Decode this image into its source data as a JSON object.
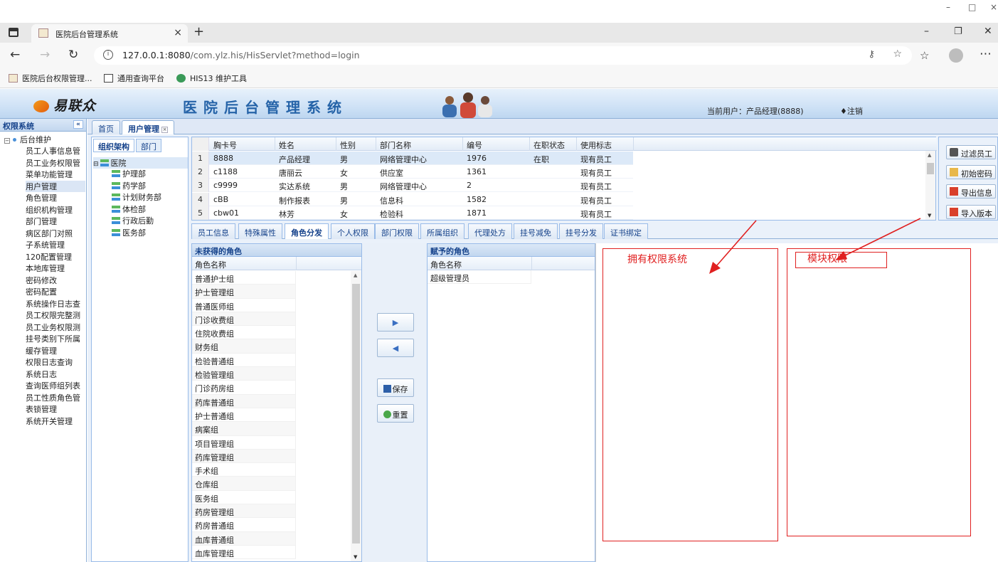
{
  "window": {
    "minimize": "–",
    "maximize": "□",
    "close": "×"
  },
  "browser": {
    "tab_title": "医院后台管理系统",
    "url_host": "127.0.0.1:8080",
    "url_path": "/com.ylz.his/HisServlet?method=login",
    "tab_controls": {
      "minimize": "–",
      "restore": "❐",
      "close": "✕"
    },
    "bookmarks": [
      "医院后台权限管理...",
      "通用查询平台",
      "HIS13 维护工具"
    ]
  },
  "header": {
    "logo_text": "易联众",
    "system_title": "医院后台管理系统",
    "current_user": "当前用户：产品经理(8888)",
    "logout": "♦注销"
  },
  "sidebar": {
    "title": "权限系统",
    "collapse": "«",
    "root": "后台维护",
    "items": [
      "员工人事信息管",
      "员工业务权限管",
      "菜单功能管理",
      "用户管理",
      "角色管理",
      "组织机构管理",
      "部门管理",
      "病区部门对照",
      "子系统管理",
      "120配置管理",
      "本地库管理",
      "密码修改",
      "密码配置",
      "系统操作日志查",
      "员工权限完整测",
      "员工业务权限测",
      "挂号类别下所属",
      "缓存管理",
      "权限日志查询",
      "系统日志",
      "查询医师组列表",
      "员工性质角色管",
      "表锁管理",
      "系统开关管理"
    ],
    "selected_index": 3
  },
  "main_tabs": [
    "首页",
    "用户管理"
  ],
  "org_panel": {
    "tabs": [
      "组织架构",
      "部门"
    ],
    "root": "医院",
    "children": [
      "护理部",
      "药学部",
      "计划财务部",
      "体检部",
      "行政后勤",
      "医务部"
    ]
  },
  "staff_grid": {
    "columns": [
      "胸卡号",
      "姓名",
      "性别",
      "部门名称",
      "编号",
      "在职状态",
      "使用标志"
    ],
    "rows": [
      {
        "n": "1",
        "card": "8888",
        "name": "产品经理",
        "sex": "男",
        "dept": "网络管理中心",
        "code": "1976",
        "status": "在职",
        "flag": "现有员工"
      },
      {
        "n": "2",
        "card": "c1188",
        "name": "唐丽云",
        "sex": "女",
        "dept": "供应室",
        "code": "1361",
        "status": "",
        "flag": "现有员工"
      },
      {
        "n": "3",
        "card": "c9999",
        "name": "实达系统",
        "sex": "男",
        "dept": "网络管理中心",
        "code": "2",
        "status": "",
        "flag": "现有员工"
      },
      {
        "n": "4",
        "card": "cBB",
        "name": "制作报表",
        "sex": "男",
        "dept": "信息科",
        "code": "1582",
        "status": "",
        "flag": "现有员工"
      },
      {
        "n": "5",
        "card": "cbw01",
        "name": "林芳",
        "sex": "女",
        "dept": "检验科",
        "code": "1871",
        "status": "",
        "flag": "现有员工"
      }
    ]
  },
  "side_buttons": [
    "过滤员工",
    "初始密码",
    "导出信息",
    "导入版本"
  ],
  "sub_tabs": [
    "员工信息",
    "特殊属性",
    "角色分发",
    "个人权限",
    "部门权限",
    "所属组织",
    "代理处方",
    "挂号减免",
    "挂号分发",
    "证书绑定"
  ],
  "sub_tab_active": 2,
  "unassigned": {
    "title": "未获得的角色",
    "column": "角色名称",
    "roles": [
      "普通护士组",
      "护士管理组",
      "普通医师组",
      "门诊收费组",
      "住院收费组",
      "财务组",
      "检验普通组",
      "检验管理组",
      "门诊药房组",
      "药库普通组",
      "护士普通组",
      "病案组",
      "项目管理组",
      "药库管理组",
      "手术组",
      "仓库组",
      "医务组",
      "药房管理组",
      "药房普通组",
      "血库普通组",
      "血库管理组"
    ]
  },
  "move_buttons": {
    "add": "▶",
    "remove": "◀",
    "save": "保存",
    "reset": "重置"
  },
  "assigned": {
    "title": "赋予的角色",
    "column": "角色名称",
    "roles": [
      "超级管理员"
    ]
  },
  "annotations": {
    "box1_text": "拥有权限系统",
    "box2_text": "模块权限",
    "color": "#e02020"
  }
}
